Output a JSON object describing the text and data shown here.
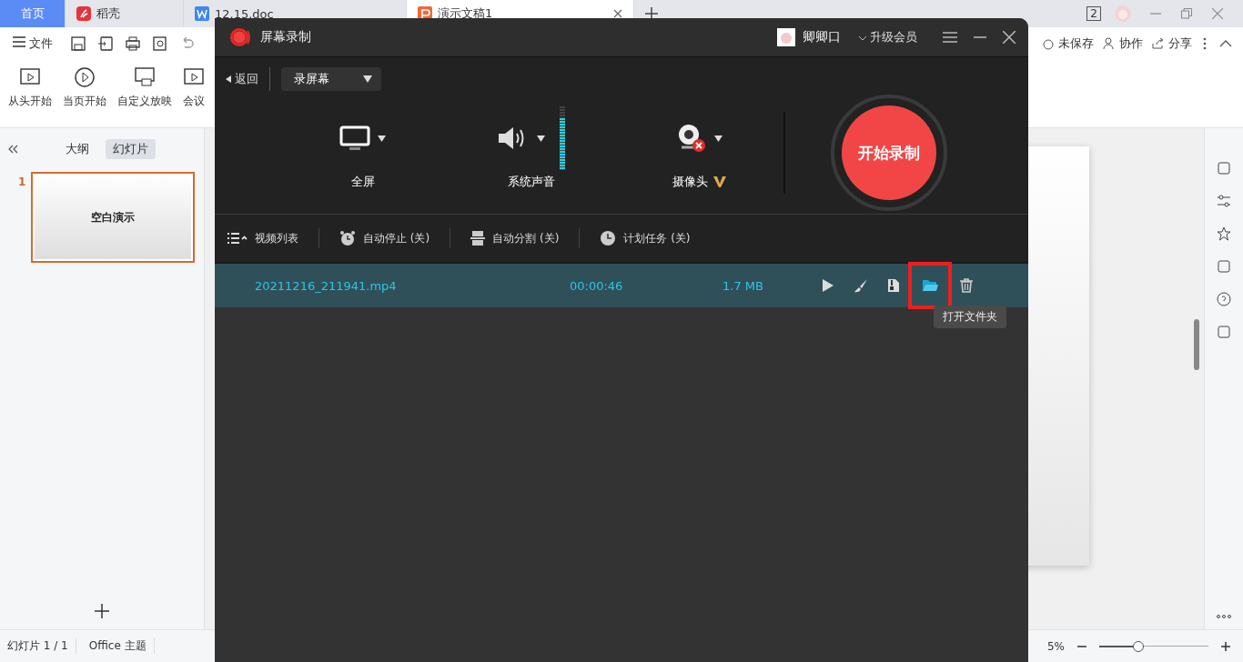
{
  "tabs": [
    {
      "label": "首页",
      "kind": "home",
      "selected": false
    },
    {
      "label": "稻壳",
      "kind": "docer",
      "selected": false
    },
    {
      "label": "12.15.doc",
      "kind": "word",
      "selected": false
    },
    {
      "label": "演示文稿1",
      "kind": "ppt",
      "selected": true
    }
  ],
  "window_badge": "2",
  "toolbar": {
    "file_menu": "文件",
    "actions": [
      {
        "kind": "cloud",
        "label": "未保存"
      },
      {
        "kind": "person",
        "label": "协作"
      },
      {
        "kind": "share",
        "label": "分享"
      }
    ]
  },
  "ribbon": [
    {
      "kind": "from-start",
      "label": "从头开始"
    },
    {
      "kind": "current",
      "label": "当页开始"
    },
    {
      "kind": "custom",
      "label": "自定义放映"
    },
    {
      "kind": "meeting",
      "label": "会议"
    }
  ],
  "panel": {
    "tabs": [
      {
        "label": "大纲",
        "selected": false
      },
      {
        "label": "幻灯片",
        "selected": true
      }
    ],
    "slides": [
      {
        "number": "1",
        "title": "空白演示",
        "selected": true
      }
    ]
  },
  "status_bar": {
    "items": [
      "幻灯片 1 / 1",
      "Office 主题"
    ],
    "zoom_reading": "5%",
    "zoom": {
      "level": 0.35
    }
  },
  "recorder": {
    "title": "屏幕录制",
    "user": "卿卿口",
    "upgrade": "升级会员",
    "back": "返回",
    "mode": "录屏幕",
    "sources": [
      {
        "kind": "screen",
        "label": "全屏"
      },
      {
        "kind": "audio",
        "label": "系统声音",
        "level": 0.82
      },
      {
        "kind": "camera",
        "label": "摄像头",
        "vip": true
      }
    ],
    "record_button": "开始录制",
    "options": [
      {
        "kind": "list",
        "label": "视频列表"
      },
      {
        "kind": "alarm",
        "label": "自动停止 (关)"
      },
      {
        "kind": "split",
        "label": "自动分割 (关)"
      },
      {
        "kind": "clock",
        "label": "计划任务 (关)"
      }
    ],
    "files": [
      {
        "name": "20211216_211941.mp4",
        "duration": "00:00:46",
        "size": "1.7 MB",
        "selected": true
      }
    ],
    "row_actions": [
      {
        "kind": "play",
        "highlighted": false
      },
      {
        "kind": "edit",
        "highlighted": false
      },
      {
        "kind": "compress",
        "highlighted": false
      },
      {
        "kind": "folder",
        "highlighted": true
      },
      {
        "kind": "delete",
        "highlighted": false
      }
    ],
    "tooltip": "打开文件夹"
  }
}
